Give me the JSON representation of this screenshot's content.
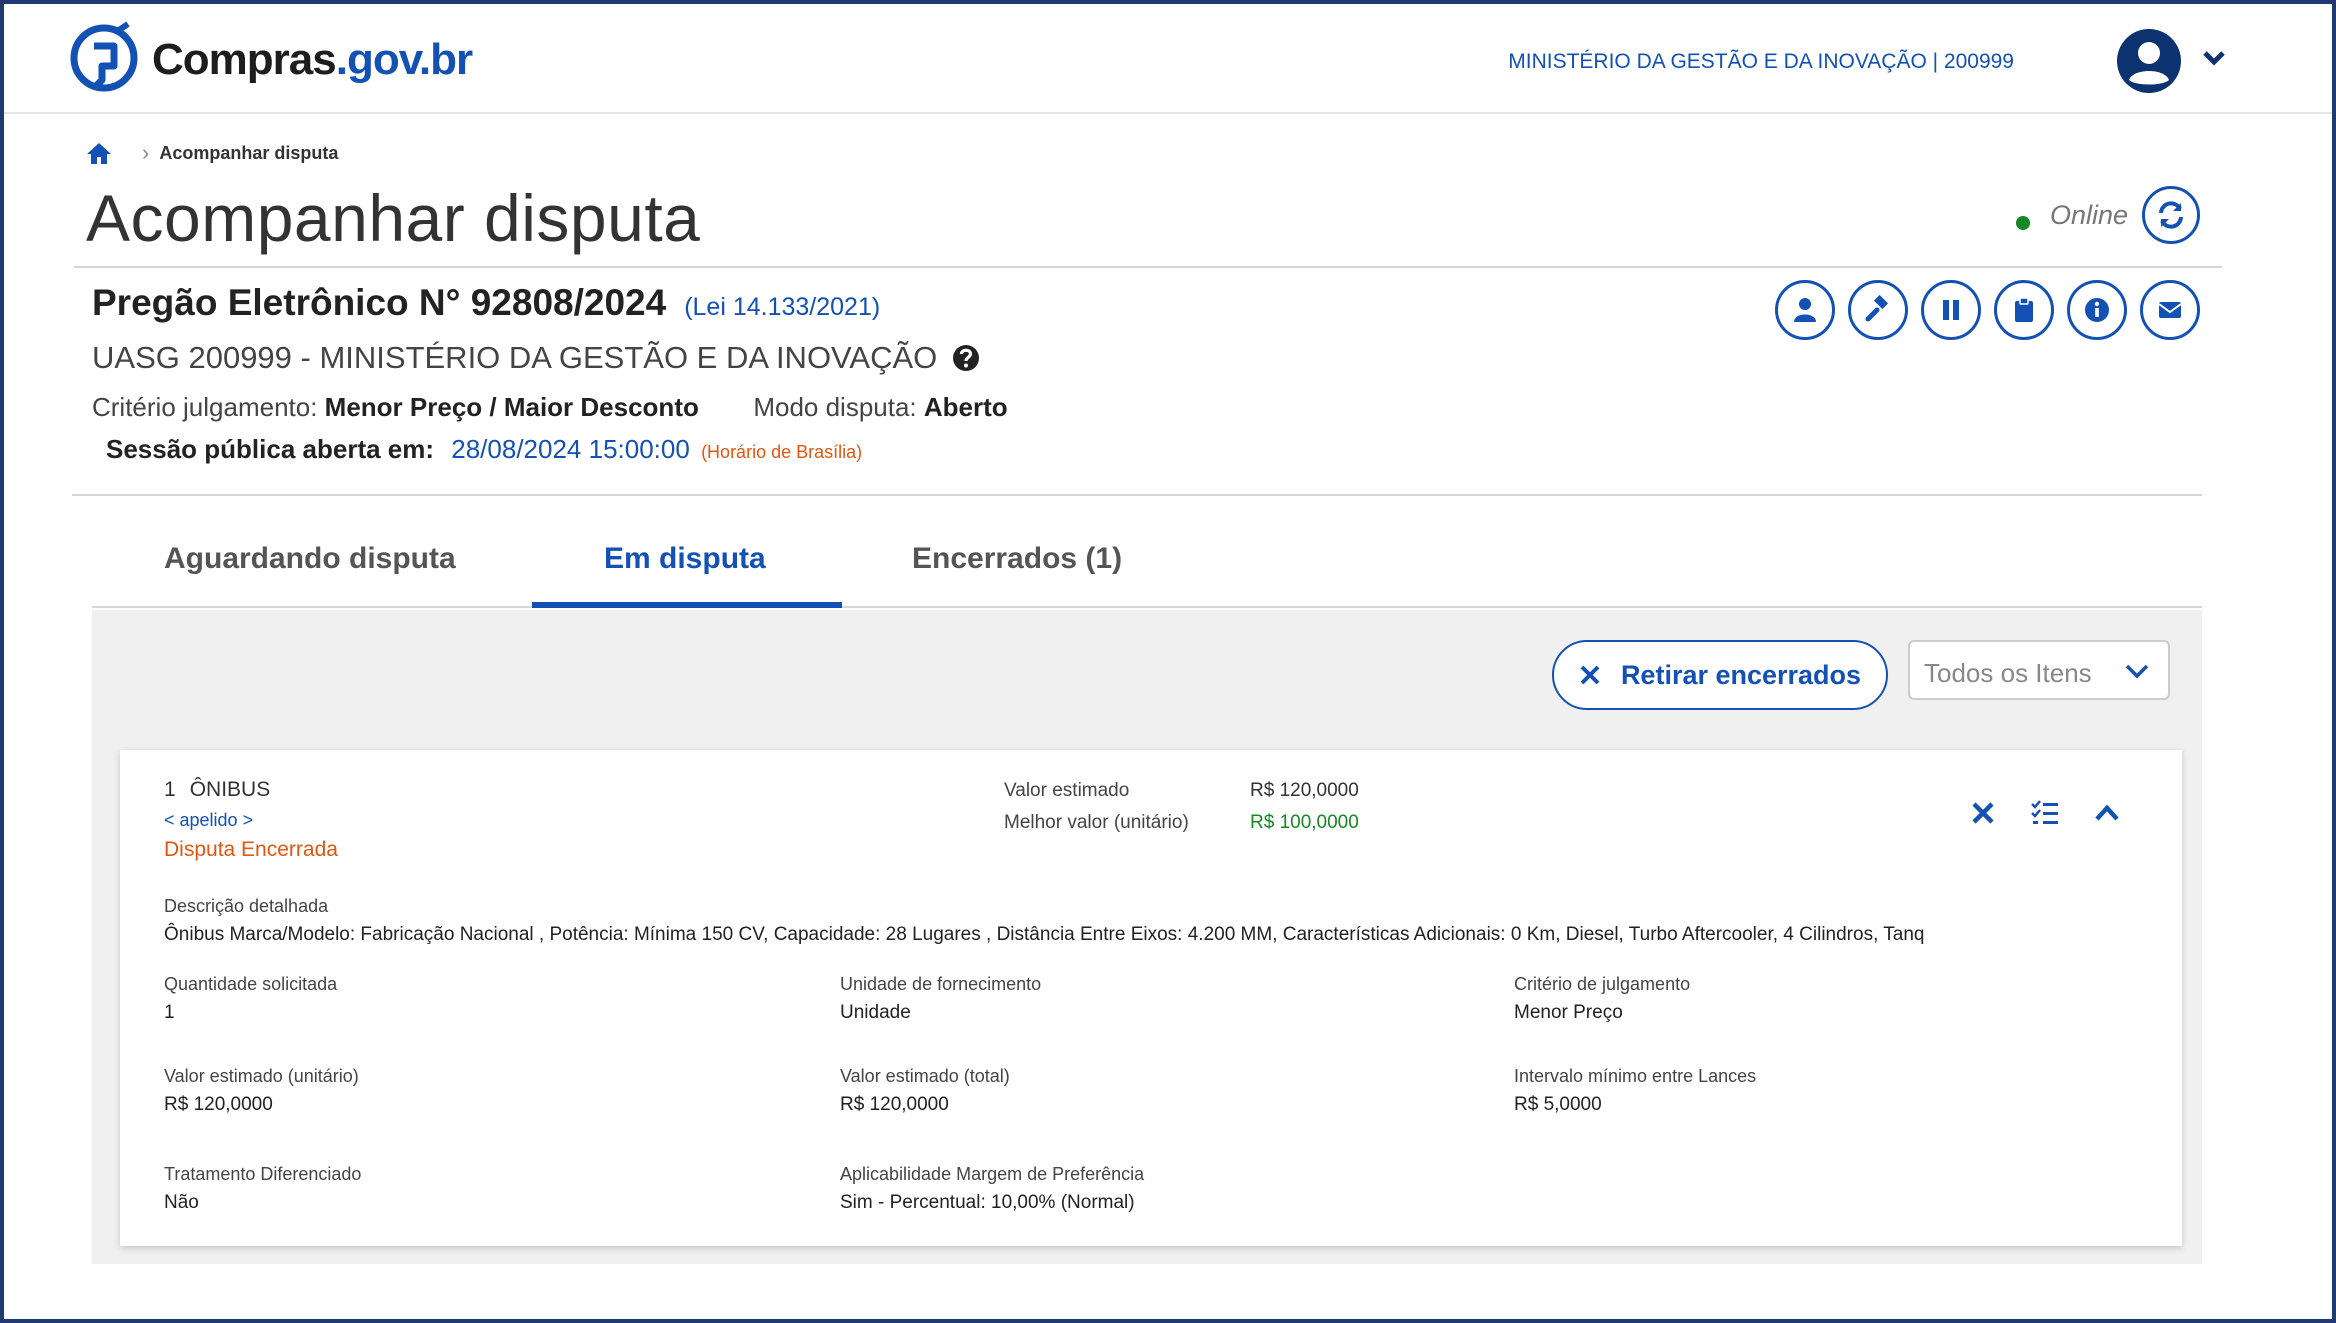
{
  "header": {
    "logo_prefix": "Compras",
    "logo_suffix": ".gov.br",
    "org": "MINISTÉRIO DA GESTÃO E DA INOVAÇÃO | 200999"
  },
  "breadcrumb": {
    "current": "Acompanhar disputa"
  },
  "page": {
    "title": "Acompanhar disputa",
    "status": "Online"
  },
  "pregao": {
    "title": "Pregão Eletrônico N° 92808/2024",
    "law": "(Lei 14.133/2021)",
    "uasg": "UASG 200999 - MINISTÉRIO DA GESTÃO E DA INOVAÇÃO",
    "criterio_label": "Critério julgamento:",
    "criterio_value": "Menor Preço / Maior Desconto",
    "modo_label": "Modo disputa:",
    "modo_value": "Aberto",
    "sessao_label": "Sessão pública aberta em:",
    "sessao_date": "28/08/2024 15:00:00",
    "sessao_tz": "(Horário de Brasília)"
  },
  "tabs": [
    {
      "label": "Aguardando disputa"
    },
    {
      "label": "Em disputa"
    },
    {
      "label": "Encerrados (1)"
    }
  ],
  "toolbar": {
    "retirar_label": "Retirar encerrados",
    "filter_value": "Todos os Itens"
  },
  "item": {
    "number": "1",
    "name": "ÔNIBUS",
    "apelido": "< apelido >",
    "status": "Disputa Encerrada",
    "valor_estimado_label": "Valor estimado",
    "valor_estimado": "R$ 120,0000",
    "melhor_valor_label": "Melhor valor (unitário)",
    "melhor_valor": "R$ 100,0000",
    "descricao_label": "Descrição detalhada",
    "descricao": "Ônibus Marca/Modelo: Fabricação Nacional , Potência: Mínima 150 CV, Capacidade: 28 Lugares , Distância Entre Eixos: 4.200 MM, Características Adicionais: 0 Km, Diesel, Turbo Aftercooler, 4 Cilindros, Tanq",
    "fields": {
      "quantidade_label": "Quantidade solicitada",
      "quantidade": "1",
      "unidade_label": "Unidade de fornecimento",
      "unidade": "Unidade",
      "criterio_label": "Critério de julgamento",
      "criterio": "Menor Preço",
      "vunit_label": "Valor estimado (unitário)",
      "vunit": "R$ 120,0000",
      "vtotal_label": "Valor estimado (total)",
      "vtotal": "R$ 120,0000",
      "intervalo_label": "Intervalo mínimo entre Lances",
      "intervalo": "R$ 5,0000",
      "tratamento_label": "Tratamento Diferenciado",
      "tratamento": "Não",
      "margem_label": "Aplicabilidade Margem de Preferência",
      "margem": "Sim - Percentual: 10,00% (Normal)"
    }
  }
}
